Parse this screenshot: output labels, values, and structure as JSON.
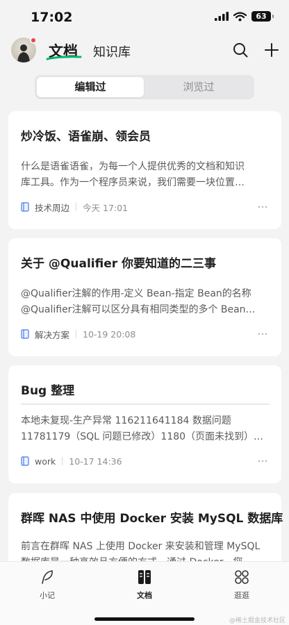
{
  "status": {
    "time": "17:02",
    "battery": "63"
  },
  "header": {
    "tab_docs": "文档",
    "tab_kb": "知识库"
  },
  "segment": {
    "active": "编辑过",
    "inactive": "浏览过"
  },
  "cards": [
    {
      "title": "炒冷饭、语雀崩、领会员",
      "summary": [
        "什么是语雀语雀，为每一个人提供优秀的文档和知识",
        "库工具。作为一个程序员来说，我们需要一块位置…"
      ],
      "book": "技术周边",
      "time": "今天 17:01"
    },
    {
      "title": "关于 @Qualifier 你要知道的二三事",
      "summary": [
        "@Qualifier注解的作用-定义 Bean-指定 Bean的名称",
        "@Qualifier注解可以区分具有相同类型的多个 Bean…"
      ],
      "book": "解决方案",
      "time": "10-19 20:08"
    },
    {
      "title": "Bug 整理",
      "summary": [
        "本地未复现-生产异常 116211641184 数据问题",
        "11781179（SQL 问题已修改）1180（页面未找到）…"
      ],
      "book": "work",
      "time": "10-17 14:36"
    },
    {
      "title": "群晖 NAS 中使用 Docker 安装 MySQL 数据库",
      "summary": [
        "前言在群晖 NAS 上使用 Docker 来安装和管理 MySQL",
        "数据库是一种高效且方便的方式。通过 Docker，您"
      ]
    }
  ],
  "nav": {
    "notes": "小记",
    "docs": "文档",
    "explore": "逛逛"
  },
  "watermark": "@稀土掘金技术社区",
  "colors": {
    "accent_green": "#00b96b",
    "book_blue": "#5e8ee8",
    "badge_red": "#e5484d"
  }
}
